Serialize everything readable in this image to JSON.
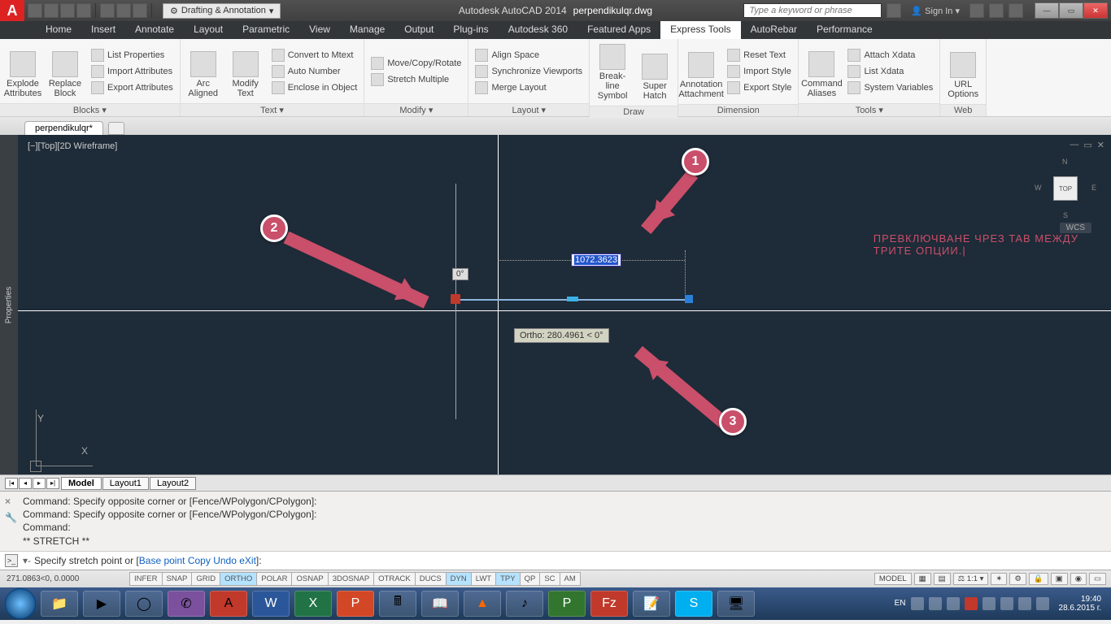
{
  "title": {
    "app": "Autodesk AutoCAD 2014",
    "file": "perpendikulqr.dwg",
    "workspace": "Drafting & Annotation"
  },
  "search": {
    "placeholder": "Type a keyword or phrase"
  },
  "signin": "Sign In",
  "menus": [
    "Home",
    "Insert",
    "Annotate",
    "Layout",
    "Parametric",
    "View",
    "Manage",
    "Output",
    "Plug-ins",
    "Autodesk 360",
    "Featured Apps",
    "Express Tools",
    "AutoRebar",
    "Performance"
  ],
  "active_menu": "Express Tools",
  "ribbon": {
    "panels": [
      {
        "title": "Blocks ▾",
        "big": [
          "Explode Attributes",
          "Replace Block"
        ],
        "small": [
          "List Properties",
          "Import Attributes",
          "Export Attributes"
        ]
      },
      {
        "title": "Text ▾",
        "big": [
          "Arc Aligned",
          "Modify Text"
        ],
        "small": [
          "Convert to Mtext",
          "Auto Number",
          "Enclose in Object"
        ]
      },
      {
        "title": "Modify ▾",
        "big": [],
        "small": [
          "Move/Copy/Rotate",
          "Stretch Multiple"
        ]
      },
      {
        "title": "Layout ▾",
        "big": [],
        "small": [
          "Align Space",
          "Synchronize Viewports",
          "Merge Layout"
        ]
      },
      {
        "title": "Draw",
        "big": [
          "Break-line Symbol",
          "Super Hatch"
        ],
        "small": []
      },
      {
        "title": "Dimension",
        "big": [
          "Annotation Attachment"
        ],
        "small": [
          "Reset Text",
          "Import Style",
          "Export Style"
        ]
      },
      {
        "title": "Tools ▾",
        "big": [
          "Command Aliases"
        ],
        "small": [
          "Attach Xdata",
          "List Xdata",
          "System Variables"
        ]
      },
      {
        "title": "Web",
        "big": [
          "URL Options"
        ],
        "small": []
      }
    ]
  },
  "filetab": "perpendikulqr*",
  "viewport": {
    "label": "[−][Top][2D Wireframe]",
    "nav_top": "TOP",
    "wcs": "WCS"
  },
  "overlay": {
    "line1": "ПРЕВКЛЮЧВАНЕ ЧРЕЗ TAB МЕЖДУ",
    "line2": "ТРИТЕ ОПЦИИ.|"
  },
  "dyn": {
    "angle": "0°",
    "value": "1072.3623",
    "tooltip": "Ortho: 280.4961 < 0°"
  },
  "callouts": {
    "c1": "1",
    "c2": "2",
    "c3": "3"
  },
  "layout_tabs": [
    "Model",
    "Layout1",
    "Layout2"
  ],
  "cmd": {
    "h1": "Command: Specify opposite corner or [Fence/WPolygon/CPolygon]:",
    "h2": "Command: Specify opposite corner or [Fence/WPolygon/CPolygon]:",
    "h3": "Command:",
    "h4": "** STRETCH **",
    "prompt_pre": "Specify stretch point or [",
    "o1": "Base point",
    "o2": "Copy",
    "o3": "Undo",
    "o4": "eXit",
    "prompt_post": "]:"
  },
  "status": {
    "coords": "271.0863<0, 0.0000",
    "toggles": [
      "INFER",
      "SNAP",
      "GRID",
      "ORTHO",
      "POLAR",
      "OSNAP",
      "3DOSNAP",
      "OTRACK",
      "DUCS",
      "DYN",
      "LWT",
      "TPY",
      "QP",
      "SC",
      "AM"
    ],
    "on": [
      "ORTHO",
      "DYN",
      "TPY"
    ],
    "model": "MODEL",
    "scale": "1:1 ▾"
  },
  "tray": {
    "lang": "EN",
    "time": "19:40",
    "date": "28.6.2015 г."
  }
}
